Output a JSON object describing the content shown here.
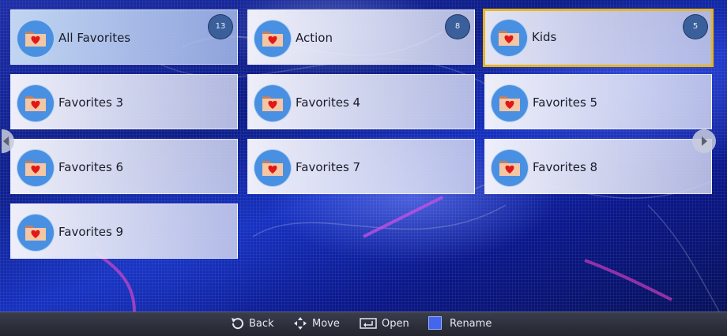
{
  "favorites": [
    {
      "label": "All Favorites",
      "count": "13"
    },
    {
      "label": "Action",
      "count": "8"
    },
    {
      "label": "Kids",
      "count": "5",
      "selected": true
    },
    {
      "label": "Favorites 3"
    },
    {
      "label": "Favorites 4"
    },
    {
      "label": "Favorites 5"
    },
    {
      "label": "Favorites 6"
    },
    {
      "label": "Favorites 7"
    },
    {
      "label": "Favorites 8"
    },
    {
      "label": "Favorites 9"
    }
  ],
  "footer": {
    "back": "Back",
    "move": "Move",
    "open": "Open",
    "rename": "Rename"
  },
  "colors": {
    "selected_border": "#e8b520",
    "folder_icon_bg": "#4a90e2",
    "heart": "#e01818",
    "rename_key": "#4466ee"
  },
  "icons": {
    "folder": "folder-heart-icon",
    "back": "back-arrow-icon",
    "move": "move-arrows-icon",
    "open": "enter-icon",
    "rename": "blue-key-icon",
    "prev": "left-arrow-icon",
    "next": "right-arrow-icon"
  }
}
